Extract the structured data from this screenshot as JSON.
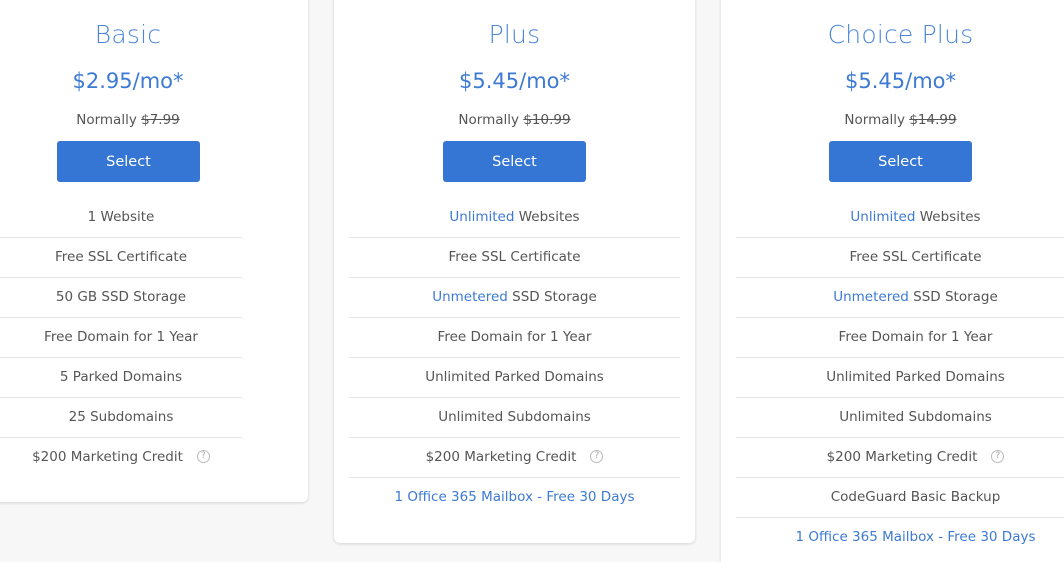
{
  "plans": [
    {
      "title": "Basic",
      "price": "$2.95/mo*",
      "normally_label": "Normally",
      "normal_price": "$7.99",
      "select_label": "Select",
      "features": [
        {
          "pre": "",
          "hl": "",
          "text": "1 Website"
        },
        {
          "pre": "",
          "hl": "",
          "text": "Free SSL Certificate"
        },
        {
          "pre": "",
          "hl": "",
          "text": "50 GB SSD Storage"
        },
        {
          "pre": "",
          "hl": "",
          "text": "Free Domain for 1 Year"
        },
        {
          "pre": "",
          "hl": "",
          "text": "5 Parked Domains"
        },
        {
          "pre": "",
          "hl": "",
          "text": "25 Subdomains"
        },
        {
          "pre": "",
          "hl": "",
          "text": "$200 Marketing Credit",
          "help": "?"
        }
      ]
    },
    {
      "title": "Plus",
      "price": "$5.45/mo*",
      "normally_label": "Normally",
      "normal_price": "$10.99",
      "select_label": "Select",
      "features": [
        {
          "hl": "Unlimited",
          "text": " Websites"
        },
        {
          "hl": "",
          "text": "Free SSL Certificate"
        },
        {
          "hl": "Unmetered",
          "text": " SSD Storage"
        },
        {
          "hl": "",
          "text": "Free Domain for 1 Year"
        },
        {
          "hl": "",
          "text": "Unlimited Parked Domains"
        },
        {
          "hl": "",
          "text": "Unlimited Subdomains"
        },
        {
          "hl": "",
          "text": "$200 Marketing Credit",
          "help": "?"
        },
        {
          "hl": "",
          "text": "1 Office 365 Mailbox - Free 30 Days",
          "link": true
        }
      ]
    },
    {
      "title": "Choice Plus",
      "price": "$5.45/mo*",
      "normally_label": "Normally",
      "normal_price": "$14.99",
      "select_label": "Select",
      "features": [
        {
          "hl": "Unlimited",
          "text": " Websites"
        },
        {
          "hl": "",
          "text": "Free SSL Certificate"
        },
        {
          "hl": "Unmetered",
          "text": " SSD Storage"
        },
        {
          "hl": "",
          "text": "Free Domain for 1 Year"
        },
        {
          "hl": "",
          "text": "Unlimited Parked Domains"
        },
        {
          "hl": "",
          "text": "Unlimited Subdomains"
        },
        {
          "hl": "",
          "text": "$200 Marketing Credit",
          "help": "?"
        },
        {
          "hl": "",
          "text": "CodeGuard Basic Backup"
        },
        {
          "hl": "",
          "text": "1 Office 365 Mailbox - Free 30 Days",
          "link": true
        }
      ]
    }
  ],
  "colors": {
    "accent": "#3d7ad3",
    "button": "#3575d3",
    "text": "#555555",
    "background": "#f7f7f7"
  }
}
